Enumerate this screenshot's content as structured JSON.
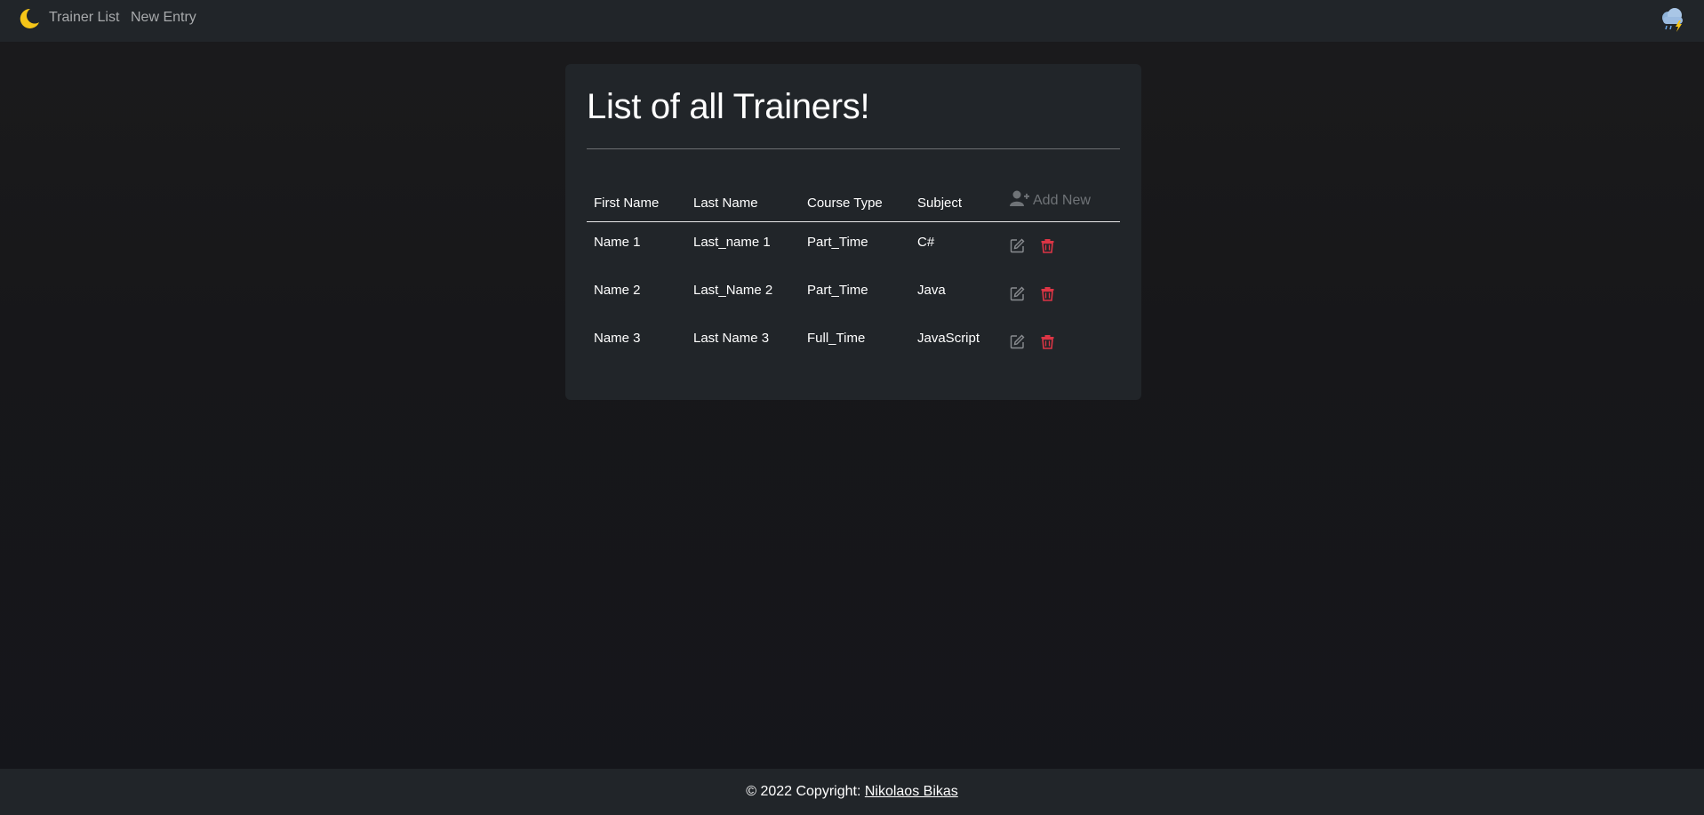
{
  "navbar": {
    "brand_icon": "moon-icon",
    "links": [
      {
        "label": "Trainer List"
      },
      {
        "label": "New Entry"
      }
    ],
    "weather_icon": "storm-cloud-icon"
  },
  "card": {
    "title": "List of all Trainers!",
    "table": {
      "headers": [
        "First Name",
        "Last Name",
        "Course Type",
        "Subject"
      ],
      "add_new_label": "Add New",
      "add_new_icon": "add-user-icon",
      "rows": [
        {
          "first_name": "Name 1",
          "last_name": "Last_name 1",
          "course_type": "Part_Time",
          "subject": "C#"
        },
        {
          "first_name": "Name 2",
          "last_name": "Last_Name 2",
          "course_type": "Part_Time",
          "subject": "Java"
        },
        {
          "first_name": "Name 3",
          "last_name": "Last Name 3",
          "course_type": "Full_Time",
          "subject": "JavaScript"
        }
      ],
      "row_actions": [
        "edit-icon",
        "trash-icon"
      ]
    }
  },
  "footer": {
    "prefix": "© 2022 Copyright: ",
    "author": "Nikolaos Bikas"
  },
  "colors": {
    "accent_moon": "#f5c518",
    "danger": "#dc3545",
    "muted": "#6f7377",
    "panel": "#212529"
  }
}
